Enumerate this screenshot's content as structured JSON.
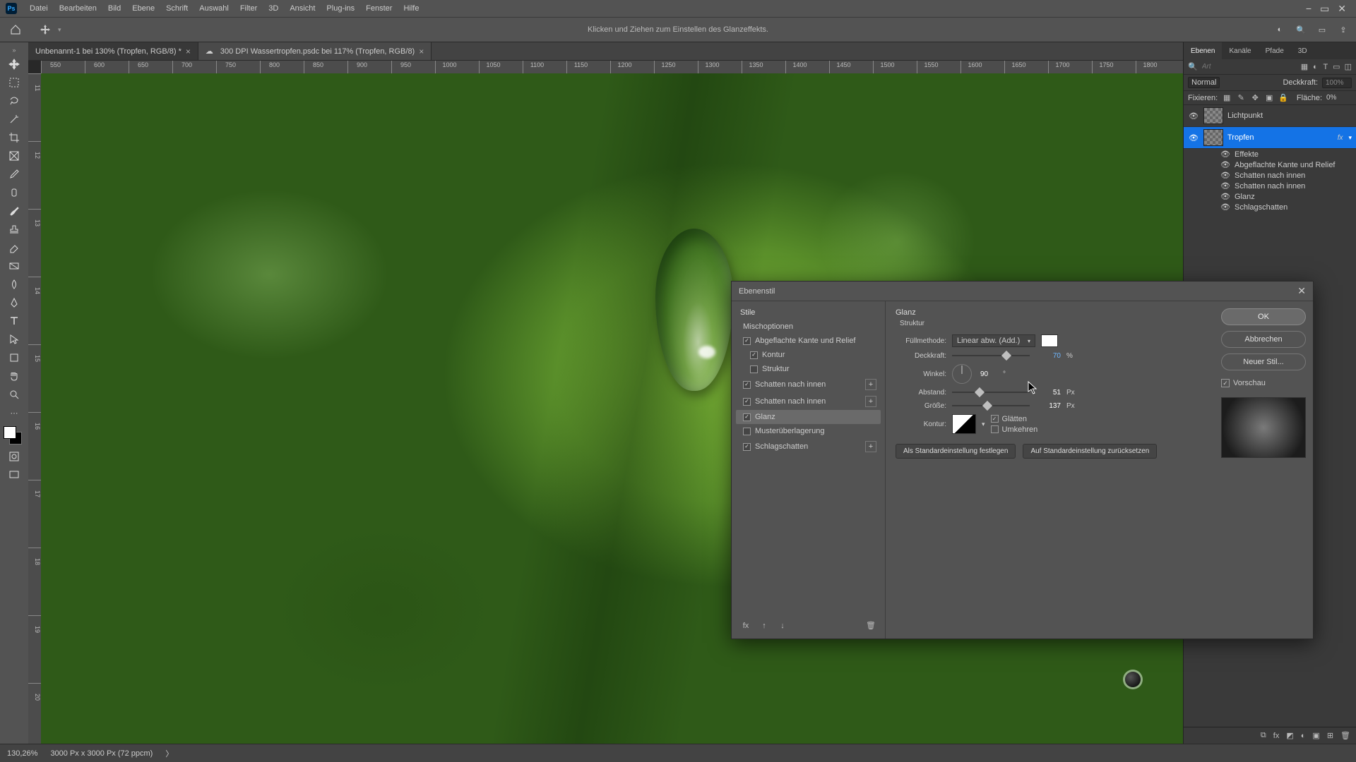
{
  "menubar": {
    "items": [
      "Datei",
      "Bearbeiten",
      "Bild",
      "Ebene",
      "Schrift",
      "Auswahl",
      "Filter",
      "3D",
      "Ansicht",
      "Plug-ins",
      "Fenster",
      "Hilfe"
    ]
  },
  "optbar": {
    "hint": "Klicken und Ziehen zum Einstellen des Glanzeffekts."
  },
  "doctabs": [
    {
      "label": "Unbenannt-1 bei 130% (Tropfen, RGB/8) *"
    },
    {
      "label": "300 DPI Wassertropfen.psdc bei 117% (Tropfen, RGB/8)"
    }
  ],
  "ruler": {
    "hticks": [
      "550",
      "600",
      "650",
      "700",
      "750",
      "800",
      "850",
      "900",
      "950",
      "1000",
      "1050",
      "1100",
      "1150",
      "1200",
      "1250",
      "1300",
      "1350",
      "1400",
      "1450",
      "1500",
      "1550",
      "1600",
      "1650",
      "1700",
      "1750",
      "1800"
    ],
    "vticks": [
      "11",
      "12",
      "13",
      "14",
      "15",
      "16",
      "17",
      "18",
      "19",
      "20"
    ]
  },
  "statusbar": {
    "zoom": "130,26%",
    "docinfo": "3000 Px x 3000 Px (72 ppcm)",
    "arrow": "〉"
  },
  "panels": {
    "tabs": [
      "Ebenen",
      "Kanäle",
      "Pfade",
      "3D"
    ],
    "search_placeholder": "Art",
    "blend_label": "Normal",
    "opacity_label": "Deckkraft:",
    "opacity_val": "100%",
    "lock_label": "Fixieren:",
    "fill_label": "Fläche:",
    "fill_val": "0%",
    "layers": [
      {
        "name": "Lichtpunkt"
      },
      {
        "name": "Tropfen"
      }
    ],
    "fx_label": "fx",
    "effects_header": "Effekte",
    "effects": [
      "Abgeflachte Kante und Relief",
      "Schatten nach innen",
      "Schatten nach innen",
      "Glanz",
      "Schlagschatten"
    ]
  },
  "dialog": {
    "title": "Ebenenstil",
    "left": {
      "header": "Stile",
      "items": [
        {
          "label": "Mischoptionen",
          "cb": null
        },
        {
          "label": "Abgeflachte Kante und Relief",
          "cb": true
        },
        {
          "label": "Kontur",
          "cb": true,
          "sub": true
        },
        {
          "label": "Struktur",
          "cb": false,
          "sub": true
        },
        {
          "label": "Schatten nach innen",
          "cb": true,
          "plus": true
        },
        {
          "label": "Schatten nach innen",
          "cb": true,
          "plus": true
        },
        {
          "label": "Glanz",
          "cb": true,
          "sel": true
        },
        {
          "label": "Musterüberlagerung",
          "cb": false
        },
        {
          "label": "Schlagschatten",
          "cb": true,
          "plus": true
        }
      ]
    },
    "mid": {
      "section": "Glanz",
      "subsection": "Struktur",
      "blend_label": "Füllmethode:",
      "blend_value": "Linear abw. (Add.)",
      "opacity_label": "Deckkraft:",
      "opacity_value": "70",
      "opacity_unit": "%",
      "angle_label": "Winkel:",
      "angle_value": "90",
      "angle_unit": "°",
      "distance_label": "Abstand:",
      "distance_value": "51",
      "distance_unit": "Px",
      "size_label": "Größe:",
      "size_value": "137",
      "size_unit": "Px",
      "contour_label": "Kontur:",
      "antialiased_label": "Glätten",
      "invert_label": "Umkehren",
      "set_default": "Als Standardeinstellung festlegen",
      "reset_default": "Auf Standardeinstellung zurücksetzen"
    },
    "right": {
      "ok": "OK",
      "cancel": "Abbrechen",
      "newstyle": "Neuer Stil...",
      "preview": "Vorschau"
    }
  }
}
